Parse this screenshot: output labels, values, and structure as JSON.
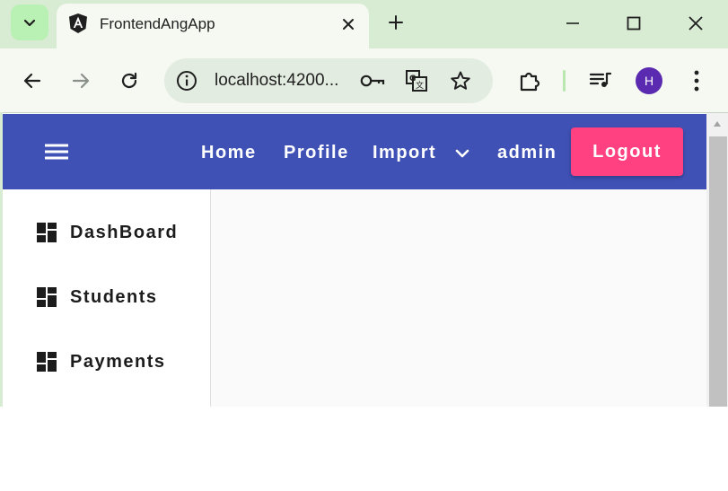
{
  "browser": {
    "tab": {
      "title": "FrontendAngApp"
    },
    "address": {
      "url": "localhost:4200..."
    },
    "profile_initial": "H",
    "colors": {
      "frame": "#d8ebd3",
      "toolbar": "#f5f9f1",
      "avatar": "#5a2bb0"
    },
    "icons": [
      "tab-search-chevron-icon",
      "angular-icon",
      "close-icon",
      "plus-icon",
      "minimize-icon",
      "maximize-icon",
      "window-close-icon",
      "back-arrow-icon",
      "forward-arrow-icon",
      "reload-icon",
      "site-info-icon",
      "key-icon",
      "translate-icon",
      "star-icon",
      "extensions-icon",
      "media-playlist-icon",
      "more-vert-icon"
    ]
  },
  "app": {
    "toolbar": {
      "nav": {
        "home": "Home",
        "profile": "Profile",
        "import": "Import",
        "user": "admin"
      },
      "logout_label": "Logout",
      "colors": {
        "primary": "#3f51b5",
        "accent": "#ff4081"
      }
    },
    "sidenav": {
      "items": [
        {
          "label": "DashBoard",
          "icon": "dashboard-icon"
        },
        {
          "label": "Students",
          "icon": "dashboard-icon"
        },
        {
          "label": "Payments",
          "icon": "dashboard-icon"
        }
      ]
    }
  }
}
